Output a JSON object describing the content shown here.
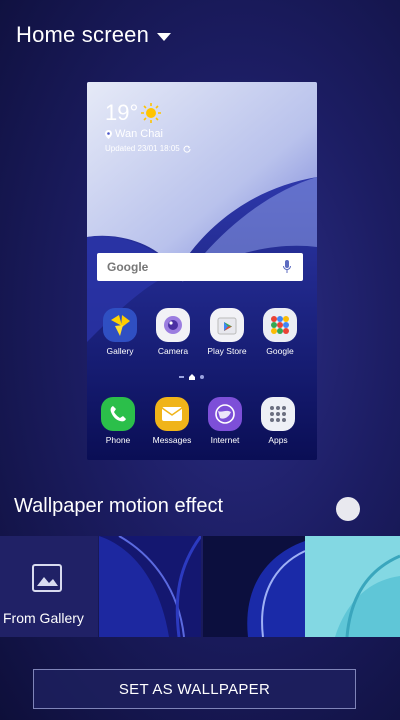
{
  "header": {
    "title": "Home screen",
    "dropdown_icon": "caret-down-icon"
  },
  "preview": {
    "weather": {
      "temperature": "19°",
      "location": "Wan Chai",
      "updated": "Updated 23/01 18:05"
    },
    "search": {
      "brand": "Google"
    },
    "apps_row1": [
      {
        "label": "Gallery",
        "icon": "gallery-icon"
      },
      {
        "label": "Camera",
        "icon": "camera-icon"
      },
      {
        "label": "Play Store",
        "icon": "play-store-icon"
      },
      {
        "label": "Google",
        "icon": "google-folder-icon"
      }
    ],
    "apps_row2": [
      {
        "label": "Phone",
        "icon": "phone-icon"
      },
      {
        "label": "Messages",
        "icon": "messages-icon"
      },
      {
        "label": "Internet",
        "icon": "internet-icon"
      },
      {
        "label": "Apps",
        "icon": "apps-grid-icon"
      }
    ]
  },
  "motion": {
    "label": "Wallpaper motion effect",
    "enabled": false
  },
  "gallery": {
    "label": "From Gallery"
  },
  "actions": {
    "set_wallpaper": "SET AS WALLPAPER"
  },
  "colors": {
    "background": "#1c1d63",
    "accent": "#7f84b8"
  }
}
